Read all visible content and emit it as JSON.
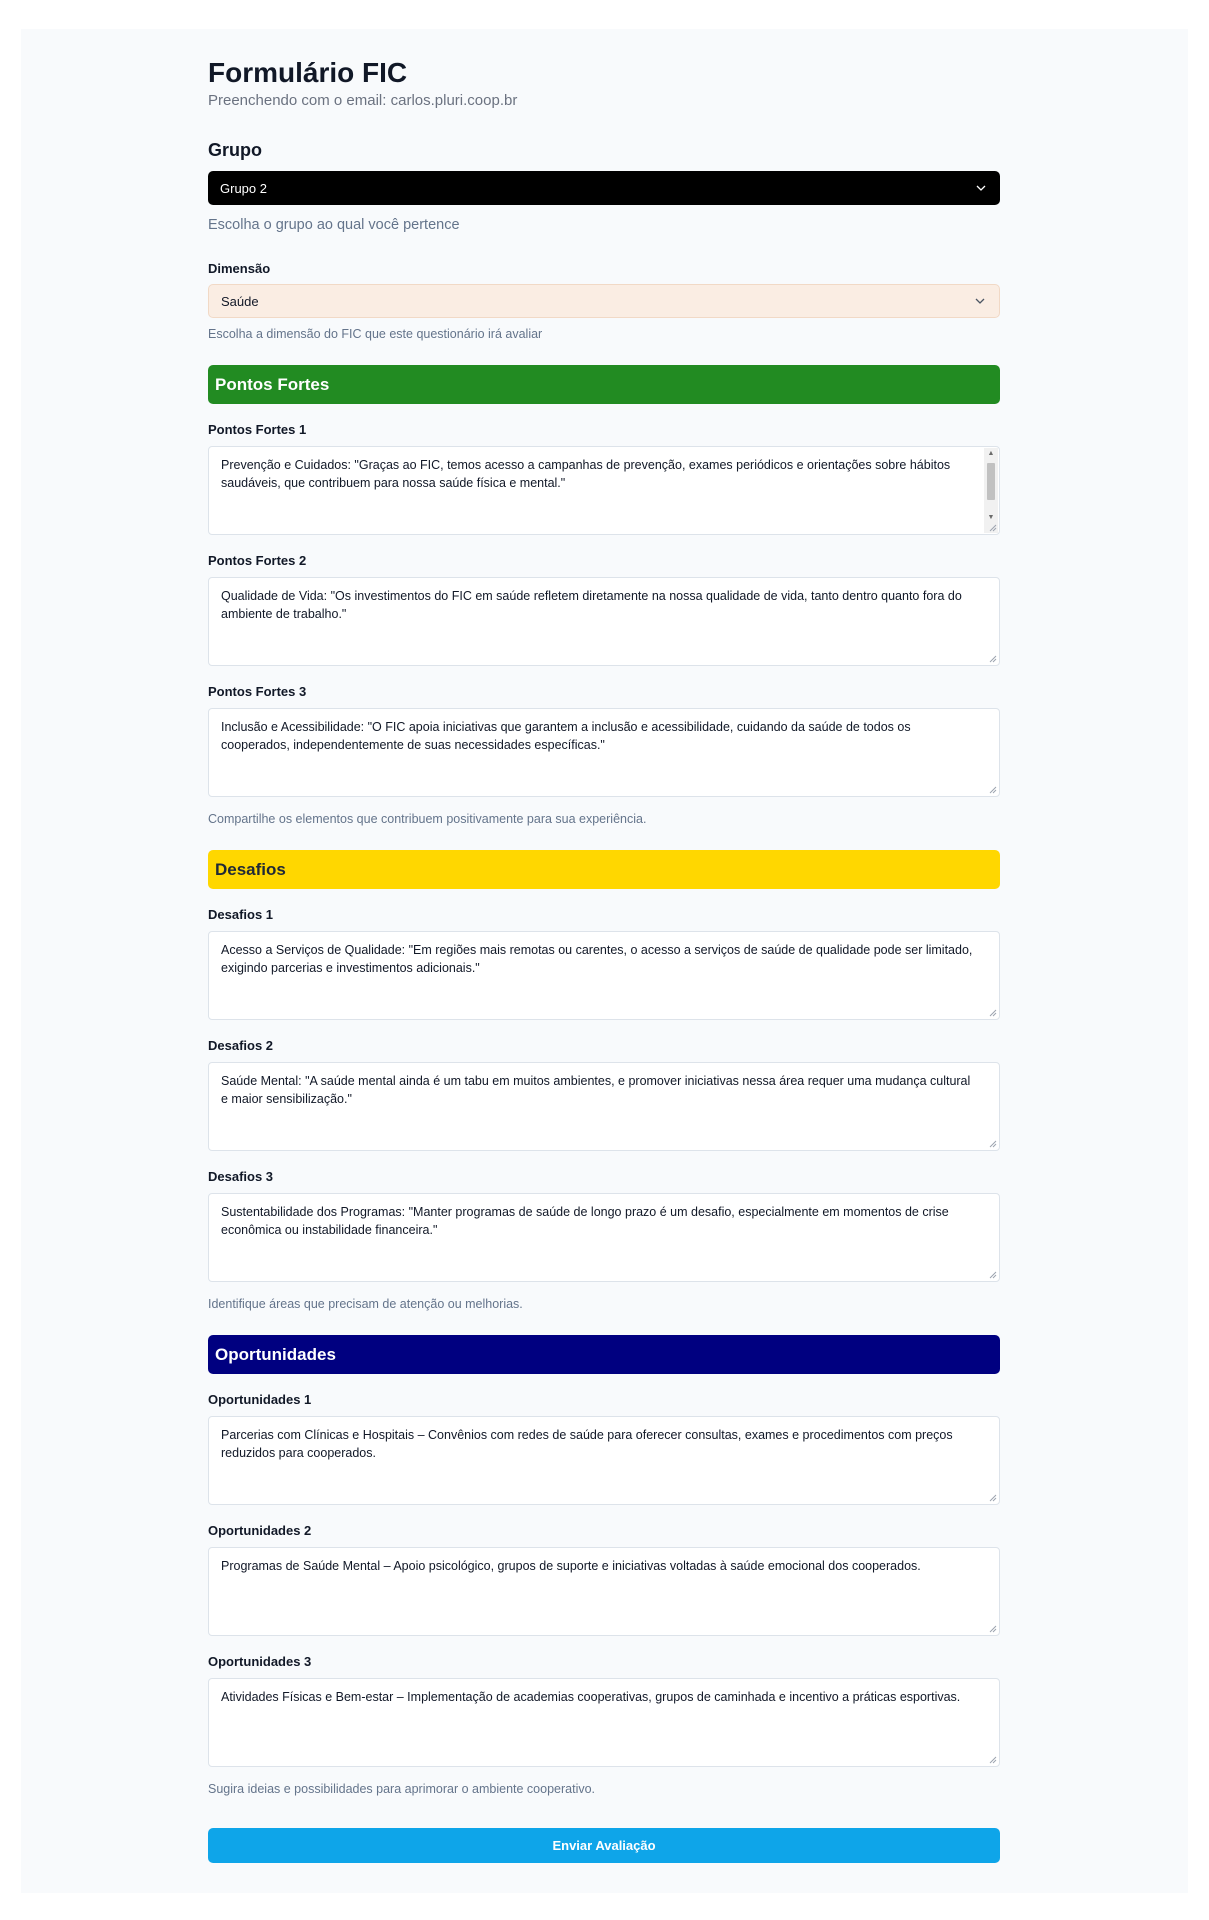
{
  "header": {
    "title": "Formulário FIC",
    "subtitle": "Preenchendo com o email: carlos.pluri.coop.br"
  },
  "grupo": {
    "label": "Grupo",
    "value": "Grupo 2",
    "help": "Escolha o grupo ao qual você pertence"
  },
  "dimensao": {
    "label": "Dimensão",
    "value": "Saúde",
    "help": "Escolha a dimensão do FIC que este questionário irá avaliar"
  },
  "pontos_fortes": {
    "title": "Pontos Fortes",
    "color": "#228b22",
    "help": "Compartilhe os elementos que contribuem positivamente para sua experiência.",
    "fields": [
      {
        "label": "Pontos Fortes 1",
        "value": "Prevenção e Cuidados: \"Graças ao FIC, temos acesso a campanhas de prevenção, exames periódicos e orientações sobre hábitos saudáveis, que contribuem para nossa saúde física e mental.\""
      },
      {
        "label": "Pontos Fortes 2",
        "value": "Qualidade de Vida: \"Os investimentos do FIC em saúde refletem diretamente na nossa qualidade de vida, tanto dentro quanto fora do ambiente de trabalho.\""
      },
      {
        "label": "Pontos Fortes 3",
        "value": "Inclusão e Acessibilidade: \"O FIC apoia iniciativas que garantem a inclusão e acessibilidade, cuidando da saúde de todos os cooperados, independentemente de suas necessidades específicas.\""
      }
    ]
  },
  "desafios": {
    "title": "Desafios",
    "color": "#ffd700",
    "help": "Identifique áreas que precisam de atenção ou melhorias.",
    "fields": [
      {
        "label": "Desafios 1",
        "value": "Acesso a Serviços de Qualidade: \"Em regiões mais remotas ou carentes, o acesso a serviços de saúde de qualidade pode ser limitado, exigindo parcerias e investimentos adicionais.\""
      },
      {
        "label": "Desafios 2",
        "value": "Saúde Mental: \"A saúde mental ainda é um tabu em muitos ambientes, e promover iniciativas nessa área requer uma mudança cultural e maior sensibilização.\""
      },
      {
        "label": "Desafios 3",
        "value": "Sustentabilidade dos Programas: \"Manter programas de saúde de longo prazo é um desafio, especialmente em momentos de crise econômica ou instabilidade financeira.\""
      }
    ]
  },
  "oportunidades": {
    "title": "Oportunidades",
    "color": "#000080",
    "help": "Sugira ideias e possibilidades para aprimorar o ambiente cooperativo.",
    "fields": [
      {
        "label": "Oportunidades 1",
        "value": "Parcerias com Clínicas e Hospitais – Convênios com redes de saúde para oferecer consultas, exames e procedimentos com preços reduzidos para cooperados."
      },
      {
        "label": "Oportunidades 2",
        "value": "Programas de Saúde Mental – Apoio psicológico, grupos de suporte e iniciativas voltadas à saúde emocional dos cooperados."
      },
      {
        "label": "Oportunidades 3",
        "value": "Atividades Físicas e Bem-estar – Implementação de academias cooperativas, grupos de caminhada e incentivo a práticas esportivas."
      }
    ]
  },
  "submit": {
    "label": "Enviar Avaliação",
    "color": "#0ea5e9"
  }
}
